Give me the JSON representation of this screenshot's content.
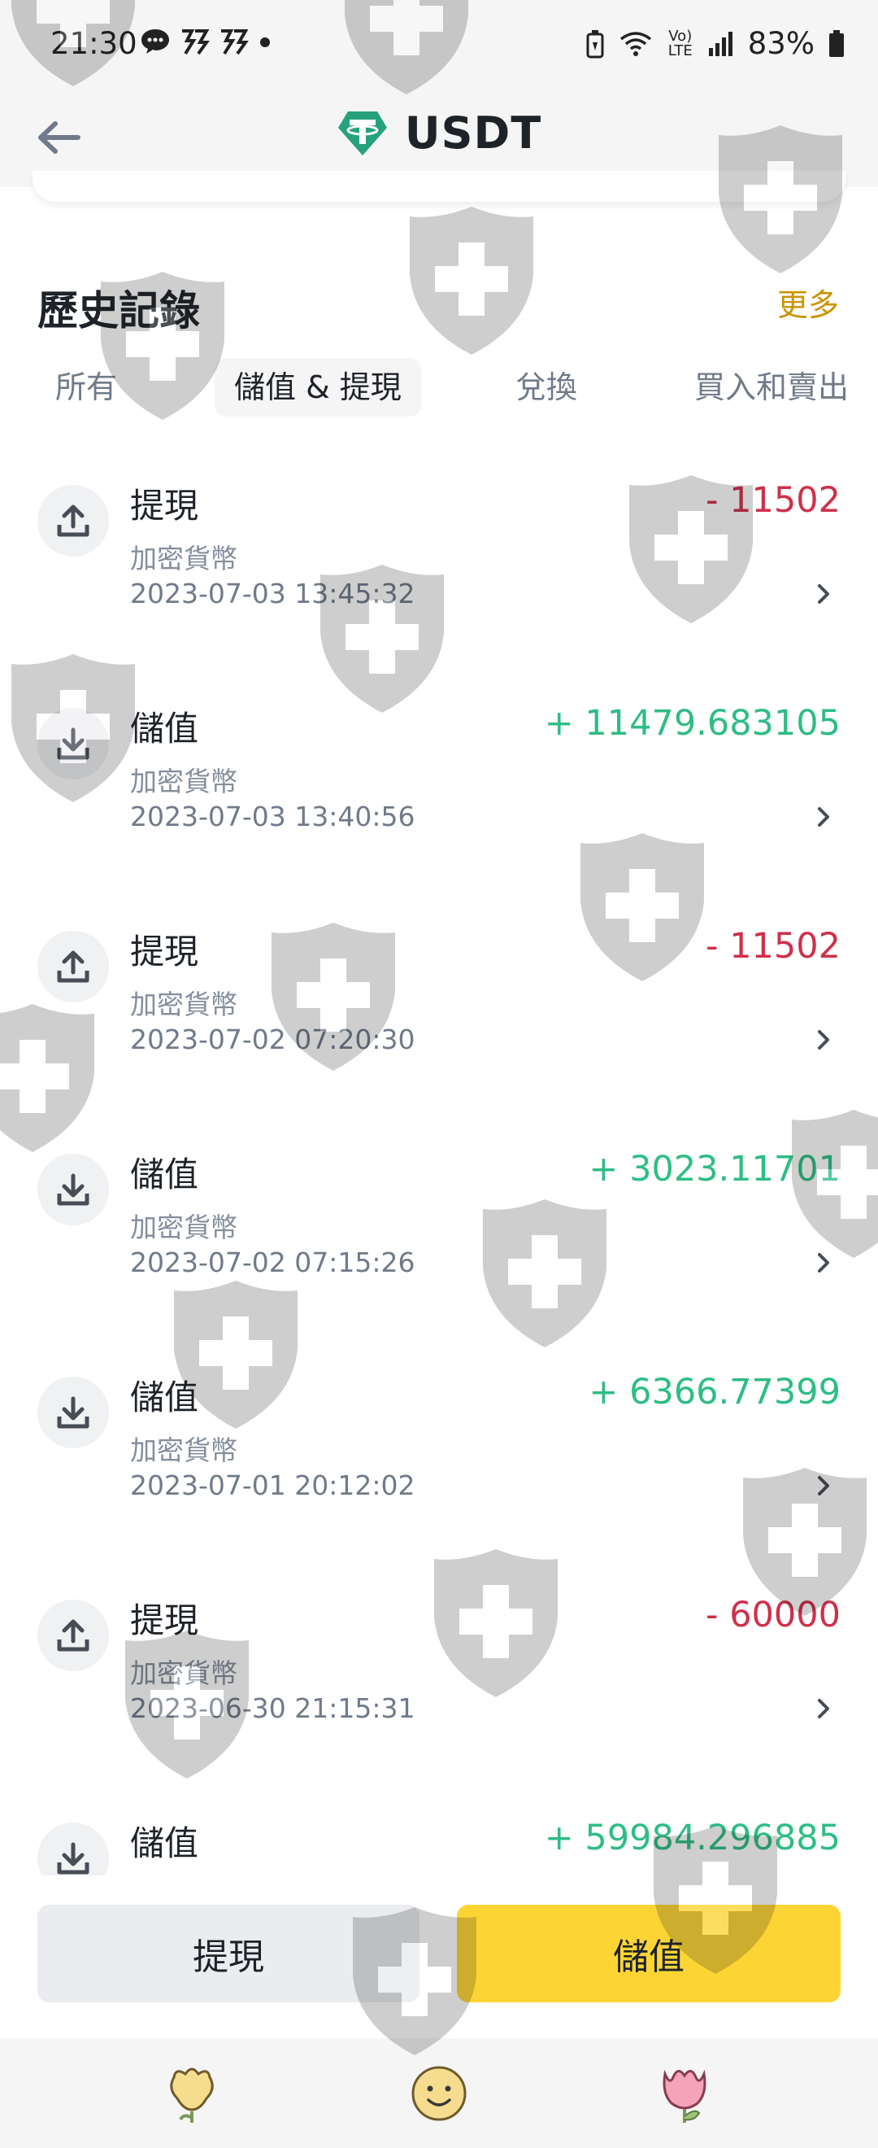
{
  "status_bar": {
    "time": "21:30",
    "battery": "83%",
    "network": "Vo) LTE",
    "icons": [
      "chat-icon",
      "notification-icon",
      "notification-icon",
      "dot-icon",
      "battery-saver-icon",
      "wifi-icon",
      "signal-icon",
      "battery-icon"
    ]
  },
  "header": {
    "title": "USDT",
    "back_icon": "arrow-left-icon",
    "coin_icon": "tether-icon"
  },
  "history": {
    "title": "歷史記錄",
    "more_label": "更多",
    "tabs": [
      {
        "label": "所有",
        "active": false
      },
      {
        "label": "儲值 & 提現",
        "active": true
      },
      {
        "label": "兌換",
        "active": false
      },
      {
        "label": "買入和賣出",
        "active": false
      }
    ]
  },
  "transactions": [
    {
      "type": "提現",
      "subtitle": "加密貨幣",
      "time": "2023-07-03 13:45:32",
      "amount": "- 11502",
      "direction": "withdraw"
    },
    {
      "type": "儲值",
      "subtitle": "加密貨幣",
      "time": "2023-07-03 13:40:56",
      "amount": "+ 11479.683105",
      "direction": "deposit"
    },
    {
      "type": "提現",
      "subtitle": "加密貨幣",
      "time": "2023-07-02 07:20:30",
      "amount": "- 11502",
      "direction": "withdraw"
    },
    {
      "type": "儲值",
      "subtitle": "加密貨幣",
      "time": "2023-07-02 07:15:26",
      "amount": "+ 3023.11701",
      "direction": "deposit"
    },
    {
      "type": "儲值",
      "subtitle": "加密貨幣",
      "time": "2023-07-01 20:12:02",
      "amount": "+ 6366.77399",
      "direction": "deposit"
    },
    {
      "type": "提現",
      "subtitle": "加密貨幣",
      "time": "2023-06-30 21:15:31",
      "amount": "- 60000",
      "direction": "withdraw"
    },
    {
      "type": "儲值",
      "subtitle": "",
      "time": "",
      "amount": "+ 59984.296885",
      "direction": "deposit"
    }
  ],
  "actions": {
    "withdraw_label": "提現",
    "deposit_label": "儲值"
  },
  "colors": {
    "negative": "#cf304a",
    "positive": "#2ebd85",
    "accent": "#fcd535",
    "more_link": "#c99400",
    "tether": "#26a17b"
  },
  "nav_icons": [
    "flower-icon",
    "smiley-icon",
    "tulip-icon"
  ]
}
